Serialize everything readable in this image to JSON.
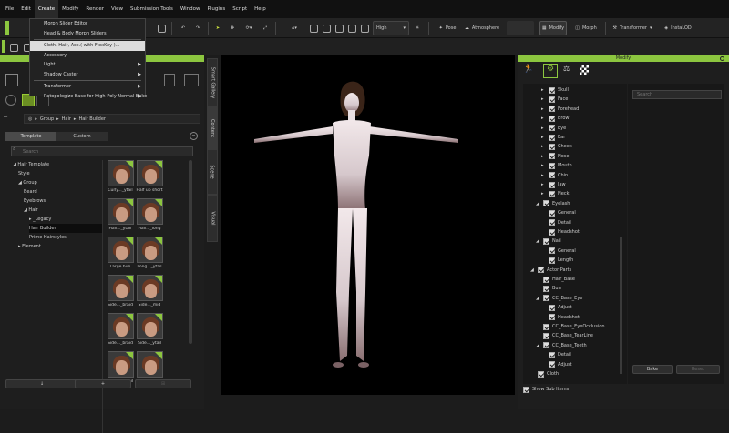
{
  "menubar": [
    "File",
    "Edit",
    "Create",
    "Modify",
    "Render",
    "View",
    "Submission Tools",
    "Window",
    "Plugins",
    "Script",
    "Help"
  ],
  "create_menu": {
    "items": [
      {
        "label": "Morph Slider Editor",
        "arrow": false,
        "hl": false
      },
      {
        "label": "Head & Body Morph Sliders",
        "arrow": false,
        "hl": false
      },
      {
        "sep": true
      },
      {
        "label": "Cloth, Hair, Acc.( with FlexKey )...",
        "arrow": false,
        "hl": true
      },
      {
        "label": "Accessory",
        "arrow": false,
        "hl": false
      },
      {
        "label": "Light",
        "arrow": true,
        "hl": false
      },
      {
        "label": "Shadow Caster",
        "arrow": true,
        "hl": false
      },
      {
        "sep": true
      },
      {
        "label": "Transformer",
        "arrow": true,
        "hl": false
      },
      {
        "label": "Retopologize Base for High-Poly Normal Bake",
        "arrow": true,
        "hl": false
      }
    ]
  },
  "toolbar": {
    "quality_value": "High",
    "pose_label": "Pose",
    "atmosphere_label": "Atmosphere",
    "modify_label": "Modify",
    "morph_label": "Morph",
    "transformer_label": "Transformer",
    "instalod_label": "InstaLOD"
  },
  "sidetabs": [
    "Smart Gallery",
    "Content",
    "Scene",
    "Visual"
  ],
  "content": {
    "breadcrumb": [
      "Group",
      "Hair",
      "Hair Builder"
    ],
    "tab_template": "Template",
    "tab_custom": "Custom",
    "search_placeholder": "Search",
    "tree": [
      {
        "label": "◢ Hair Template",
        "indent": 0,
        "sel": false
      },
      {
        "label": "Style",
        "indent": 1,
        "sel": false
      },
      {
        "label": "◢ Group",
        "indent": 1,
        "sel": false
      },
      {
        "label": "Beard",
        "indent": 2,
        "sel": false
      },
      {
        "label": "Eyebrows",
        "indent": 2,
        "sel": false
      },
      {
        "label": "◢ Hair",
        "indent": 2,
        "sel": false
      },
      {
        "label": "▸ _Legacy",
        "indent": 3,
        "sel": false
      },
      {
        "label": "Hair Builder",
        "indent": 3,
        "sel": true
      },
      {
        "label": "Prime Hairstyles",
        "indent": 3,
        "sel": false
      },
      {
        "label": "▸ Element",
        "indent": 1,
        "sel": false
      }
    ],
    "thumbs": [
      {
        "label": "Curly..._ytail"
      },
      {
        "label": "Half up short"
      },
      {
        "label": "Half..._ytail"
      },
      {
        "label": "Half..._long"
      },
      {
        "label": "Large bun"
      },
      {
        "label": "Long..._ytail"
      },
      {
        "label": "Side..._braid"
      },
      {
        "label": "Side..._mid"
      },
      {
        "label": "Side..._braid"
      },
      {
        "label": "Side..._ytail"
      },
      {
        "label": "Top K..._ytail"
      },
      {
        "label": "Top K..._braid"
      }
    ]
  },
  "modify": {
    "title": "Modify",
    "search_placeholder": "Search",
    "bake_label": "Bake",
    "reset_label": "Reset",
    "show_sub_items": "Show Sub Items",
    "tree": [
      {
        "label": "Skull",
        "indent": 3,
        "exp": true,
        "checked": true
      },
      {
        "label": "Face",
        "indent": 3,
        "exp": true,
        "checked": true
      },
      {
        "label": "Forehead",
        "indent": 3,
        "exp": true,
        "checked": true
      },
      {
        "label": "Brow",
        "indent": 3,
        "exp": true,
        "checked": true
      },
      {
        "label": "Eye",
        "indent": 3,
        "exp": true,
        "checked": true
      },
      {
        "label": "Ear",
        "indent": 3,
        "exp": true,
        "checked": true
      },
      {
        "label": "Cheek",
        "indent": 3,
        "exp": true,
        "checked": true
      },
      {
        "label": "Nose",
        "indent": 3,
        "exp": true,
        "checked": true
      },
      {
        "label": "Mouth",
        "indent": 3,
        "exp": true,
        "checked": true
      },
      {
        "label": "Chin",
        "indent": 3,
        "exp": true,
        "checked": true
      },
      {
        "label": "Jaw",
        "indent": 3,
        "exp": true,
        "checked": true
      },
      {
        "label": "Neck",
        "indent": 3,
        "exp": true,
        "checked": true
      },
      {
        "label": "Eyelash",
        "indent": 2,
        "exp": true,
        "checked": true
      },
      {
        "label": "General",
        "indent": 3,
        "exp": false,
        "checked": true
      },
      {
        "label": "Detail",
        "indent": 3,
        "exp": false,
        "checked": true
      },
      {
        "label": "Headshot",
        "indent": 3,
        "exp": false,
        "checked": true
      },
      {
        "label": "Nail",
        "indent": 2,
        "exp": true,
        "checked": true
      },
      {
        "label": "General",
        "indent": 3,
        "exp": false,
        "checked": true
      },
      {
        "label": "Length",
        "indent": 3,
        "exp": false,
        "checked": true
      },
      {
        "label": "Actor Parts",
        "indent": 1,
        "exp": true,
        "checked": true
      },
      {
        "label": "Hair_Base",
        "indent": 2,
        "exp": false,
        "checked": true
      },
      {
        "label": "Bun",
        "indent": 2,
        "exp": false,
        "checked": true
      },
      {
        "label": "CC_Base_Eye",
        "indent": 2,
        "exp": true,
        "checked": true
      },
      {
        "label": "Adjust",
        "indent": 3,
        "exp": false,
        "checked": true
      },
      {
        "label": "Headshot",
        "indent": 3,
        "exp": false,
        "checked": true
      },
      {
        "label": "CC_Base_EyeOcclusion",
        "indent": 2,
        "exp": false,
        "checked": true
      },
      {
        "label": "CC_Base_TearLine",
        "indent": 2,
        "exp": false,
        "checked": true
      },
      {
        "label": "CC_Base_Teeth",
        "indent": 2,
        "exp": true,
        "checked": true
      },
      {
        "label": "Detail",
        "indent": 3,
        "exp": false,
        "checked": true
      },
      {
        "label": "Adjust",
        "indent": 3,
        "exp": false,
        "checked": true
      },
      {
        "label": "Cloth",
        "indent": 1,
        "exp": false,
        "checked": true
      }
    ]
  },
  "colors": {
    "accent": "#8cc63f",
    "menu_bg": "#222222",
    "viewport_bg": "#000000"
  }
}
